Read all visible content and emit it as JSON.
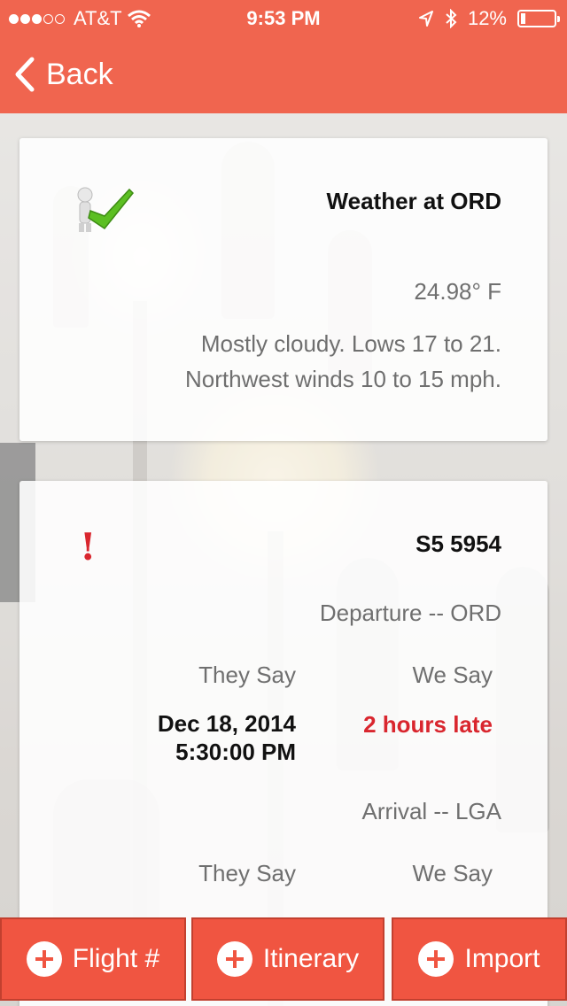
{
  "status_bar": {
    "carrier": "AT&T",
    "time": "9:53 PM",
    "battery": "12%"
  },
  "nav": {
    "back_label": "Back"
  },
  "weather_card": {
    "title": "Weather at ORD",
    "temperature": "24.98° F",
    "forecast_line1": "Mostly cloudy. Lows 17 to 21.",
    "forecast_line2": "Northwest winds 10 to 15 mph."
  },
  "flight_card": {
    "flight_number": "S5 5954",
    "departure_heading": "Departure -- ORD",
    "departure_they_say_label": "They Say",
    "departure_we_say_label": "We Say",
    "departure_date": "Dec 18, 2014",
    "departure_time": "5:30:00 PM",
    "departure_prediction": "2 hours late",
    "arrival_heading": "Arrival -- LGA",
    "arrival_they_say_label": "They Say",
    "arrival_we_say_label": "We Say"
  },
  "bottom_bar": {
    "flight_button": "Flight #",
    "itinerary_button": "Itinerary",
    "import_button": "Import"
  },
  "colors": {
    "accent": "#f0654f",
    "alert_red": "#d9262e",
    "check_green": "#5cbf22"
  }
}
